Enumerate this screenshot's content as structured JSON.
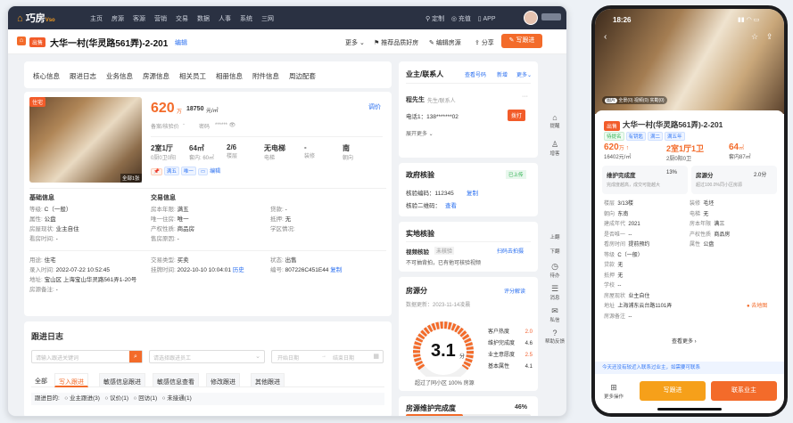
{
  "nav": {
    "logo": "巧房",
    "logo_sub": "Vso",
    "items": [
      "主页",
      "房源",
      "客源",
      "营销",
      "交易",
      "数据",
      "人事",
      "系统",
      "三网"
    ],
    "right": [
      "定制",
      "充值",
      "APP"
    ]
  },
  "title": {
    "tag": "出售",
    "name": "大华一村(华灵路561弄)-2-201",
    "edit": "编辑",
    "actions": [
      "更多",
      "推荐品质好房",
      "编辑房源",
      "分享"
    ],
    "primary": "写跟进"
  },
  "tabs": [
    "核心信息",
    "跟进日志",
    "业务信息",
    "房源信息",
    "相关员工",
    "相册信息",
    "附件信息",
    "周边配套"
  ],
  "listing": {
    "img_tag": "住宅",
    "img_count": "全部1张",
    "price": "620",
    "price_unit": "万",
    "unit_price": "18750",
    "unit_price_unit": "元/㎡",
    "adjust": "调价",
    "record_label": "备案/核验价",
    "record_value": "-",
    "pwd_label": "密码",
    "pwd_value": "****** 👁",
    "specs": [
      {
        "v": "2室1厅",
        "k": "0厨0卫0阳"
      },
      {
        "v": "64㎡",
        "k": "套内: 60㎡"
      },
      {
        "v": "2/6",
        "k": "楼层"
      },
      {
        "v": "无电梯",
        "k": "电梯"
      },
      {
        "v": "-",
        "k": "装修"
      },
      {
        "v": "南",
        "k": "朝向"
      }
    ],
    "chips": [
      "满五",
      "唯一",
      "",
      "编辑"
    ]
  },
  "basic": {
    "h": "基础信息",
    "rows": [
      [
        "等级:",
        "C（一般）"
      ],
      [
        "属性:",
        "公盘"
      ],
      [
        "房屋现状:",
        "业主自住"
      ],
      [
        "看房时间:",
        "-"
      ]
    ]
  },
  "trade": {
    "h": "交易信息",
    "rows": [
      [
        "房本年限:",
        "满五"
      ],
      [
        "唯一住房:",
        "唯一"
      ],
      [
        "产权性质:",
        "商品房"
      ],
      [
        "售房原因:",
        "-"
      ]
    ]
  },
  "trade2": {
    "rows": [
      [
        "贷款:",
        "-"
      ],
      [
        "抵押:",
        "无"
      ],
      [
        "学区情况:",
        ""
      ]
    ]
  },
  "extra": {
    "rows": [
      [
        "用途:",
        "住宅",
        "交易类型:",
        "买卖",
        "状态:",
        "出售"
      ],
      [
        "录入时间:",
        "2022-07-22 10:52:45",
        "挂牌时间:",
        "2022-10-10 10:04:01",
        "编号:",
        "807226C451E44"
      ],
      [
        "地址:",
        "宝山区 上海宝山华灵路561弄1-20号",
        "",
        "",
        "",
        ""
      ],
      [
        "房源备注:",
        "-",
        "",
        "",
        "",
        ""
      ]
    ],
    "history": "历史",
    "copy": "复制"
  },
  "follow": {
    "h": "跟进日志",
    "search_ph": "请输入跟进关键词",
    "staff_ph": "请选择跟进员工",
    "start_ph": "开始日期",
    "end_ph": "结束日期",
    "tabs": [
      "全部",
      "写入跟进",
      "敏感信息跟进",
      "敏感信息查看",
      "修改跟进",
      "其他跟进"
    ],
    "filter": "跟进目的:",
    "opts": [
      "业主跟进(3)",
      "议价(1)",
      "回访(1)",
      "未接通(1)"
    ]
  },
  "owner": {
    "h": "业主/联系人",
    "view": "查看号码",
    "add": "新增",
    "more": "更多",
    "name": "程先生",
    "name_sub": "先生/联系人",
    "phone": "电话1：138*******02",
    "call": "拨打",
    "expand": "展开更多"
  },
  "gov": {
    "h": "政府核验",
    "badge": "已上传",
    "code_l": "核验编码：112345",
    "copy": "复制",
    "qr_l": "核验二维码：",
    "qr_v": "查看"
  },
  "inspect": {
    "h": "实地核验",
    "video": "视频核验",
    "status": "未核验",
    "scan": "扫码去拍摄",
    "note": "不可抽背拍，已有他可核验视频"
  },
  "score": {
    "h": "房源分",
    "date": "数据更新：2023-11-14凌晨",
    "link": "评分解读",
    "value": "3.1",
    "unit": "分",
    "rank": "超过了同小区 100% 房源",
    "items": [
      [
        "客户热度",
        "2.0"
      ],
      [
        "维护完成度",
        "4.6"
      ],
      [
        "业主意愿度",
        "2.5"
      ],
      [
        "基本属性",
        "4.1"
      ]
    ]
  },
  "maint": {
    "h": "房源维护完成度",
    "v": "46%"
  },
  "side": [
    "提醒",
    "增客",
    "上翻",
    "下翻",
    "待办",
    "消息",
    "私信",
    "帮助反馈"
  ],
  "phone": {
    "time": "18:26",
    "tags": [
      "图片",
      "全景(0)",
      "视频(0)",
      "实勘(0)"
    ],
    "tag": "出售",
    "name": "大华一村(华灵路561弄)-2-201",
    "chips": [
      "待提名",
      "有钥匙",
      "满二",
      "满五年"
    ],
    "price": "620",
    "price_u": "万",
    "unit": "16402元/㎡",
    "rooms": "2室1厅1卫",
    "rooms_l": "2厨0阳0卫",
    "area": "64",
    "area_u": "㎡",
    "area_l": "套内87㎡",
    "m1_h": "维护完成度",
    "m1_v": "13%",
    "m1_d": "完成度越高，成交可能越大",
    "m2_h": "房源分",
    "m2_v": "2.0分",
    "m2_d": "超过100.0%同小区房源",
    "rows": [
      [
        "楼层",
        "3/13楼",
        "装修",
        "毛坯"
      ],
      [
        "朝向",
        "东南",
        "电梯",
        "无"
      ],
      [
        "建成年代",
        "2021",
        "房本年限",
        "满三"
      ],
      [
        "是否唯一",
        "--",
        "产权性质",
        "商品房"
      ],
      [
        "看房时间",
        "提前预约",
        "属性",
        "公盘"
      ],
      [
        "等级",
        "C（一般）",
        "",
        ""
      ],
      [
        "贷款",
        "无",
        "",
        ""
      ],
      [
        "抵押",
        "无",
        "",
        ""
      ],
      [
        "学校",
        "--",
        "",
        ""
      ],
      [
        "房屋现状",
        "业主自住",
        "",
        ""
      ],
      [
        "地址",
        "上海浦东云台路1101弄",
        "",
        ""
      ],
      [
        "房源备注",
        "--",
        "",
        ""
      ]
    ],
    "map": "去地图",
    "more": "查看更多",
    "notice": "今天还没有较近入联系过业主，如需要可联系",
    "b_more": "更多操作",
    "b1": "写跟进",
    "b2": "联系业主"
  }
}
